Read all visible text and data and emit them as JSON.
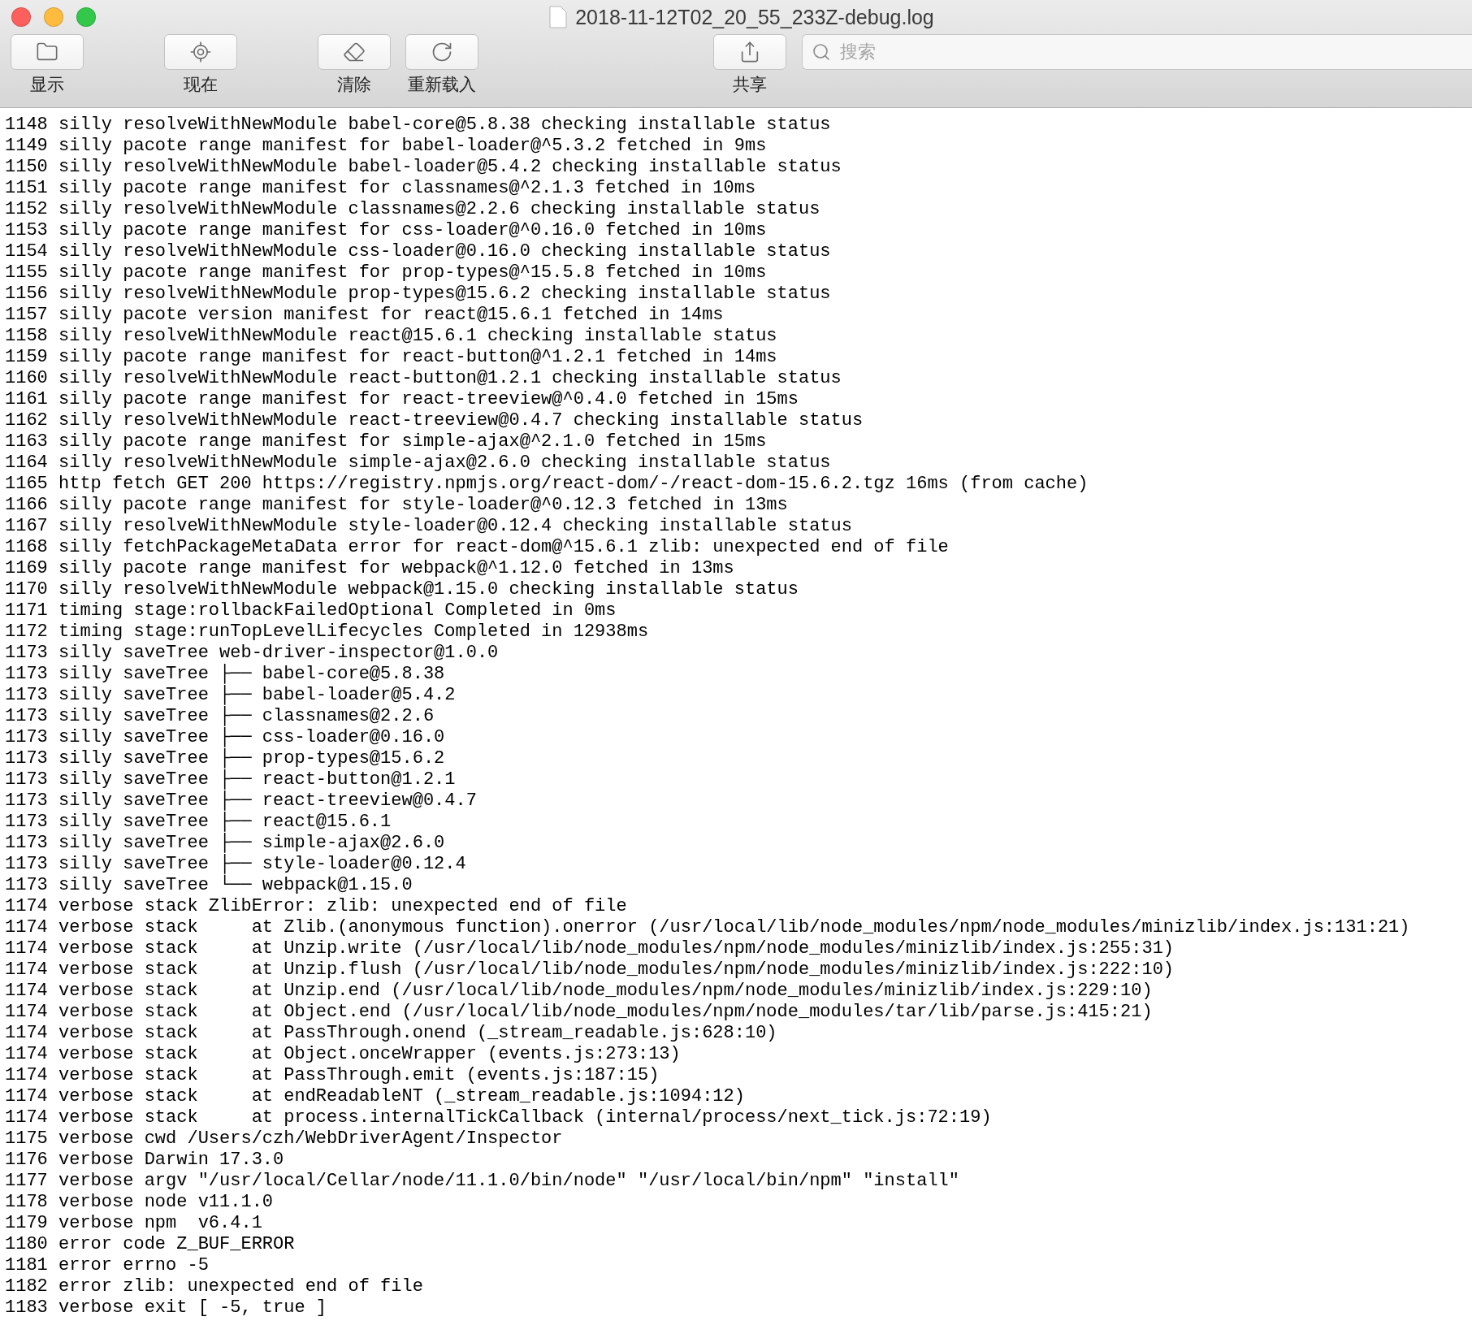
{
  "window": {
    "title": "2018-11-12T02_20_55_233Z-debug.log"
  },
  "toolbar": {
    "left_items": [
      {
        "kind": "folder",
        "label": "显示"
      },
      {
        "kind": "now",
        "label": "现在"
      },
      {
        "kind": "clear",
        "label": "清除"
      },
      {
        "kind": "reload",
        "label": "重新载入"
      }
    ],
    "right_items": [
      {
        "kind": "share",
        "label": "共享"
      }
    ],
    "search": {
      "placeholder": "搜索"
    }
  },
  "log_lines": [
    "1148 silly resolveWithNewModule babel-core@5.8.38 checking installable status",
    "1149 silly pacote range manifest for babel-loader@^5.3.2 fetched in 9ms",
    "1150 silly resolveWithNewModule babel-loader@5.4.2 checking installable status",
    "1151 silly pacote range manifest for classnames@^2.1.3 fetched in 10ms",
    "1152 silly resolveWithNewModule classnames@2.2.6 checking installable status",
    "1153 silly pacote range manifest for css-loader@^0.16.0 fetched in 10ms",
    "1154 silly resolveWithNewModule css-loader@0.16.0 checking installable status",
    "1155 silly pacote range manifest for prop-types@^15.5.8 fetched in 10ms",
    "1156 silly resolveWithNewModule prop-types@15.6.2 checking installable status",
    "1157 silly pacote version manifest for react@15.6.1 fetched in 14ms",
    "1158 silly resolveWithNewModule react@15.6.1 checking installable status",
    "1159 silly pacote range manifest for react-button@^1.2.1 fetched in 14ms",
    "1160 silly resolveWithNewModule react-button@1.2.1 checking installable status",
    "1161 silly pacote range manifest for react-treeview@^0.4.0 fetched in 15ms",
    "1162 silly resolveWithNewModule react-treeview@0.4.7 checking installable status",
    "1163 silly pacote range manifest for simple-ajax@^2.1.0 fetched in 15ms",
    "1164 silly resolveWithNewModule simple-ajax@2.6.0 checking installable status",
    "1165 http fetch GET 200 https://registry.npmjs.org/react-dom/-/react-dom-15.6.2.tgz 16ms (from cache)",
    "1166 silly pacote range manifest for style-loader@^0.12.3 fetched in 13ms",
    "1167 silly resolveWithNewModule style-loader@0.12.4 checking installable status",
    "1168 silly fetchPackageMetaData error for react-dom@^15.6.1 zlib: unexpected end of file",
    "1169 silly pacote range manifest for webpack@^1.12.0 fetched in 13ms",
    "1170 silly resolveWithNewModule webpack@1.15.0 checking installable status",
    "1171 timing stage:rollbackFailedOptional Completed in 0ms",
    "1172 timing stage:runTopLevelLifecycles Completed in 12938ms",
    "1173 silly saveTree web-driver-inspector@1.0.0",
    "1173 silly saveTree ├── babel-core@5.8.38",
    "1173 silly saveTree ├── babel-loader@5.4.2",
    "1173 silly saveTree ├── classnames@2.2.6",
    "1173 silly saveTree ├── css-loader@0.16.0",
    "1173 silly saveTree ├── prop-types@15.6.2",
    "1173 silly saveTree ├── react-button@1.2.1",
    "1173 silly saveTree ├── react-treeview@0.4.7",
    "1173 silly saveTree ├── react@15.6.1",
    "1173 silly saveTree ├── simple-ajax@2.6.0",
    "1173 silly saveTree ├── style-loader@0.12.4",
    "1173 silly saveTree └── webpack@1.15.0",
    "1174 verbose stack ZlibError: zlib: unexpected end of file",
    "1174 verbose stack     at Zlib.(anonymous function).onerror (/usr/local/lib/node_modules/npm/node_modules/minizlib/index.js:131:21)",
    "1174 verbose stack     at Unzip.write (/usr/local/lib/node_modules/npm/node_modules/minizlib/index.js:255:31)",
    "1174 verbose stack     at Unzip.flush (/usr/local/lib/node_modules/npm/node_modules/minizlib/index.js:222:10)",
    "1174 verbose stack     at Unzip.end (/usr/local/lib/node_modules/npm/node_modules/minizlib/index.js:229:10)",
    "1174 verbose stack     at Object.end (/usr/local/lib/node_modules/npm/node_modules/tar/lib/parse.js:415:21)",
    "1174 verbose stack     at PassThrough.onend (_stream_readable.js:628:10)",
    "1174 verbose stack     at Object.onceWrapper (events.js:273:13)",
    "1174 verbose stack     at PassThrough.emit (events.js:187:15)",
    "1174 verbose stack     at endReadableNT (_stream_readable.js:1094:12)",
    "1174 verbose stack     at process.internalTickCallback (internal/process/next_tick.js:72:19)",
    "1175 verbose cwd /Users/czh/WebDriverAgent/Inspector",
    "1176 verbose Darwin 17.3.0",
    "1177 verbose argv \"/usr/local/Cellar/node/11.1.0/bin/node\" \"/usr/local/bin/npm\" \"install\"",
    "1178 verbose node v11.1.0",
    "1179 verbose npm  v6.4.1",
    "1180 error code Z_BUF_ERROR",
    "1181 error errno -5",
    "1182 error zlib: unexpected end of file",
    "1183 verbose exit [ -5, true ]"
  ]
}
